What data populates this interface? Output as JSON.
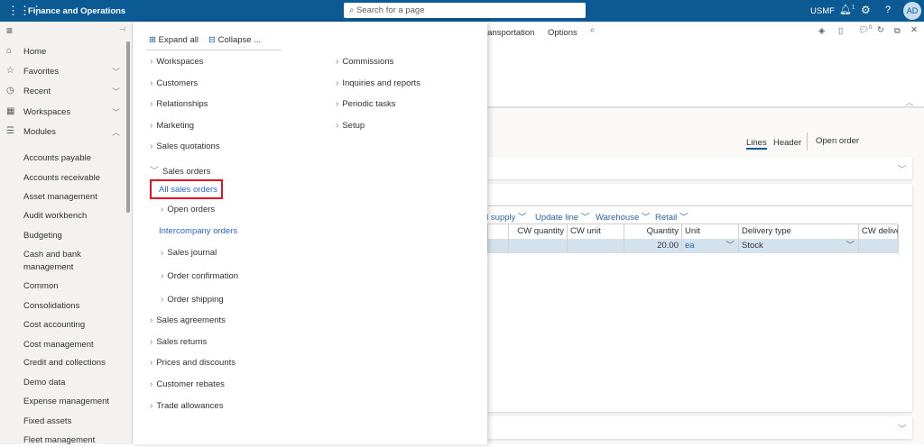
{
  "topbar": {
    "app_title": "Finance and Operations",
    "search_placeholder": "Search for a page",
    "company": "USMF",
    "notification_count": "1",
    "avatar_initials": "AD"
  },
  "sidebar": {
    "nav": [
      {
        "label": "Home",
        "icon": "home-icon"
      },
      {
        "label": "Favorites",
        "icon": "star-icon"
      },
      {
        "label": "Recent",
        "icon": "clock-icon"
      },
      {
        "label": "Workspaces",
        "icon": "workspaces-icon"
      },
      {
        "label": "Modules",
        "icon": "modules-icon"
      }
    ],
    "modules": [
      "Accounts payable",
      "Accounts receivable",
      "Asset management",
      "Audit workbench",
      "Budgeting",
      "Cash and bank management",
      "Common",
      "Consolidations",
      "Cost accounting",
      "Cost management",
      "Credit and collections",
      "Demo data",
      "Expense management",
      "Fixed assets",
      "Fleet management"
    ]
  },
  "flyout": {
    "expand_all": "Expand all",
    "collapse_all": "Collapse ...",
    "left": [
      "Workspaces",
      "Customers",
      "Relationships",
      "Marketing",
      "Sales quotations",
      "Sales orders",
      "All sales orders",
      "Open orders",
      "Intercompany orders",
      "Sales journal",
      "Order confirmation",
      "Order shipping",
      "Sales agreements",
      "Sales returns",
      "Prices and discounts",
      "Customer rebates",
      "Trade allowances"
    ],
    "right": [
      "Commissions",
      "Inquiries and reports",
      "Periodic tasks",
      "Setup"
    ]
  },
  "main": {
    "action_tabs": [
      "ransportation",
      "Options"
    ],
    "chat_count": "0",
    "view_tabs": [
      "Lines",
      "Header"
    ],
    "open_order": "Open order",
    "toolbar": [
      "d supply",
      "Update line",
      "Warehouse",
      "Retail"
    ],
    "columns": [
      "CW quantity",
      "CW unit",
      "Quantity",
      "Unit",
      "Delivery type",
      "CW deliver"
    ],
    "row": {
      "cw_quantity": "",
      "cw_unit": "",
      "quantity": "20.00",
      "unit": "ea",
      "delivery_type": "Stock",
      "cw_deliver": ""
    }
  },
  "colors": {
    "topbar": "#0c5a94",
    "highlight": "#e81123",
    "link": "#2b63d9"
  }
}
